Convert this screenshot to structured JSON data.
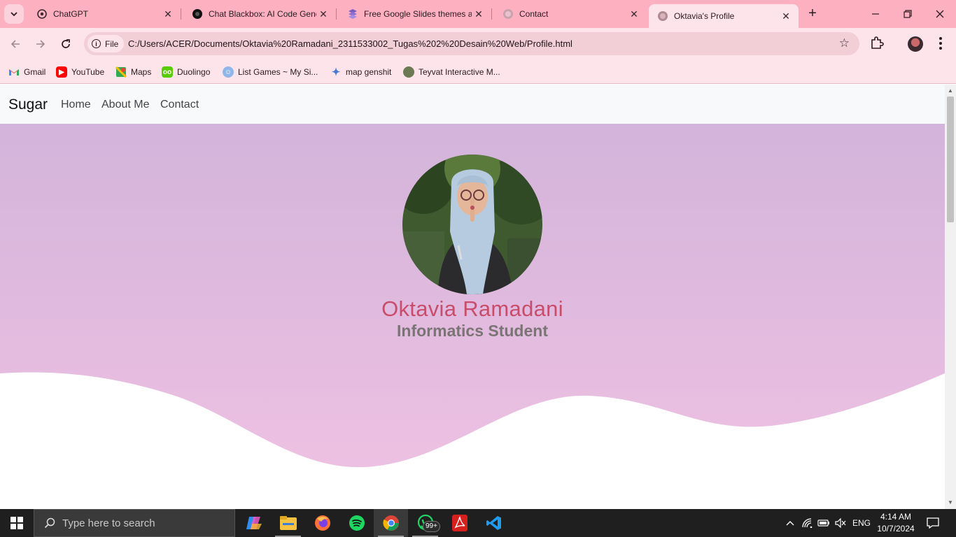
{
  "browser": {
    "tabs": [
      {
        "title": "ChatGPT",
        "icon": "chatgpt-icon"
      },
      {
        "title": "Chat Blackbox: AI Code Generation",
        "icon": "blackbox-icon"
      },
      {
        "title": "Free Google Slides themes and Powerpoint templates",
        "icon": "slidesgo-icon"
      },
      {
        "title": "Contact",
        "icon": "globe-icon"
      },
      {
        "title": "Oktavia's Profile",
        "icon": "globe-icon",
        "active": true
      }
    ],
    "new_tab": "+",
    "file_chip": "File",
    "url": "C:/Users/ACER/Documents/Oktavia%20Ramadani_2311533002_Tugas%202%20Desain%20Web/Profile.html",
    "bookmarks": [
      {
        "label": "Gmail",
        "icon": "gmail-icon"
      },
      {
        "label": "YouTube",
        "icon": "youtube-icon"
      },
      {
        "label": "Maps",
        "icon": "maps-icon"
      },
      {
        "label": "Duolingo",
        "icon": "duolingo-icon"
      },
      {
        "label": "List Games ~ My Si...",
        "icon": "games-icon"
      },
      {
        "label": "map genshit",
        "icon": "sparkle-icon"
      },
      {
        "label": "Teyvat Interactive M...",
        "icon": "teyvat-icon"
      }
    ],
    "colors": {
      "tabstrip": "#fdb0c0",
      "toolbar": "#fde4ea",
      "omnibox": "#f2cfd7"
    }
  },
  "page": {
    "navbar": {
      "brand": "Sugar",
      "links": [
        "Home",
        "About Me",
        "Contact"
      ]
    },
    "hero": {
      "name": "Oktavia Ramadani",
      "role": "Informatics Student",
      "colors": {
        "name": "#c94d6a",
        "role": "#7a7474",
        "gradient_top": "#d3b4da",
        "gradient_bottom": "#f0c2e2"
      }
    }
  },
  "taskbar": {
    "search_placeholder": "Type here to search",
    "apps": [
      "copilot-icon",
      "file-explorer-icon",
      "firefox-icon",
      "spotify-icon",
      "chrome-icon",
      "whatsapp-icon",
      "acrobat-icon",
      "vscode-icon"
    ],
    "whatsapp_badge": "99+",
    "language": "ENG",
    "time": "4:14 AM",
    "date": "10/7/2024"
  }
}
